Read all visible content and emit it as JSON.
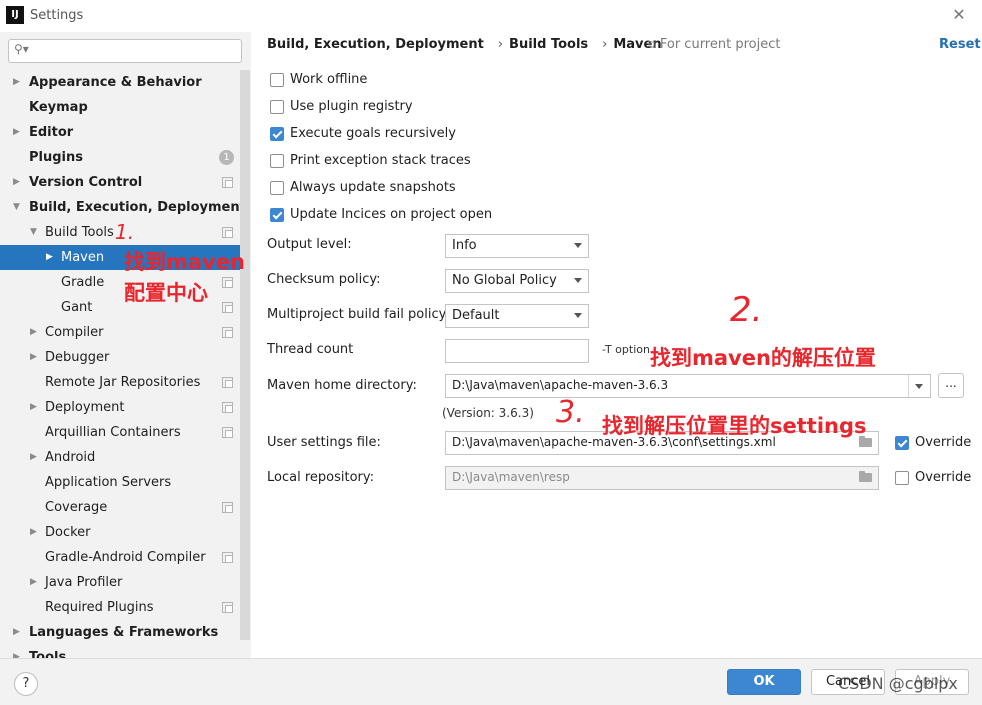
{
  "window": {
    "title": "Settings",
    "logo": "IJ"
  },
  "search": {
    "placeholder": ""
  },
  "sidebar": {
    "items": [
      {
        "label": "Appearance & Behavior"
      },
      {
        "label": "Keymap"
      },
      {
        "label": "Editor"
      },
      {
        "label": "Plugins",
        "badge": "1"
      },
      {
        "label": "Version Control"
      },
      {
        "label": "Build, Execution, Deployment"
      },
      {
        "label": "Build Tools"
      },
      {
        "label": "Maven"
      },
      {
        "label": "Gradle"
      },
      {
        "label": "Gant"
      },
      {
        "label": "Compiler"
      },
      {
        "label": "Debugger"
      },
      {
        "label": "Remote Jar Repositories"
      },
      {
        "label": "Deployment"
      },
      {
        "label": "Arquillian Containers"
      },
      {
        "label": "Android"
      },
      {
        "label": "Application Servers"
      },
      {
        "label": "Coverage"
      },
      {
        "label": "Docker"
      },
      {
        "label": "Gradle-Android Compiler"
      },
      {
        "label": "Java Profiler"
      },
      {
        "label": "Required Plugins"
      },
      {
        "label": "Languages & Frameworks"
      },
      {
        "label": "Tools"
      }
    ]
  },
  "breadcrumb": {
    "items": [
      "Build, Execution, Deployment",
      "Build Tools",
      "Maven"
    ],
    "separator": "›",
    "scope": "For current project"
  },
  "reset_label": "Reset",
  "checkboxes": [
    {
      "label": "Work offline",
      "checked": false
    },
    {
      "label": "Use plugin registry",
      "checked": false
    },
    {
      "label": "Execute goals recursively",
      "checked": true
    },
    {
      "label": "Print exception stack traces",
      "checked": false
    },
    {
      "label": "Always update snapshots",
      "checked": false
    },
    {
      "label": "Update Incices on project open",
      "checked": true
    }
  ],
  "fields": {
    "output_level": {
      "label": "Output level:",
      "value": "Info"
    },
    "checksum_policy": {
      "label": "Checksum policy:",
      "value": "No Global Policy"
    },
    "multiproject_policy": {
      "label": "Multiproject build fail policy:",
      "value": "Default"
    },
    "thread_count": {
      "label": "Thread count",
      "value": "",
      "hint": "-T option"
    },
    "maven_home": {
      "label": "Maven home directory:",
      "value": "D:\\Java\\maven\\apache-maven-3.6.3",
      "version": "(Version: 3.6.3)",
      "browse_label": "..."
    },
    "user_settings": {
      "label": "User settings file:",
      "value": "D:\\Java\\maven\\apache-maven-3.6.3\\conf\\settings.xml",
      "override_label": "Override",
      "override_checked": true
    },
    "local_repo": {
      "label": "Local repository:",
      "value": "D:\\Java\\maven\\resp",
      "override_label": "Override",
      "override_checked": false
    }
  },
  "annotations": {
    "num1": "1.",
    "text1_line1": "找到maven",
    "text1_line2": "配置中心",
    "num2": "2.",
    "text2": "找到maven的解压位置",
    "num3": "3.",
    "text3": "找到解压位置里的settings"
  },
  "footer": {
    "help": "?",
    "ok": "OK",
    "cancel": "Cancel",
    "apply": "Apply",
    "watermark": "CSDN @cgblpx"
  },
  "colors": {
    "accent": "#3d86d1",
    "selection": "#2675bf",
    "annotation": "#e8262d",
    "link": "#2470b3"
  },
  "icons": [
    "search-icon",
    "close-icon",
    "help-icon",
    "folder-icon",
    "project-scope-icon",
    "expand-arrow-icon",
    "dropdown-arrow-icon"
  ]
}
